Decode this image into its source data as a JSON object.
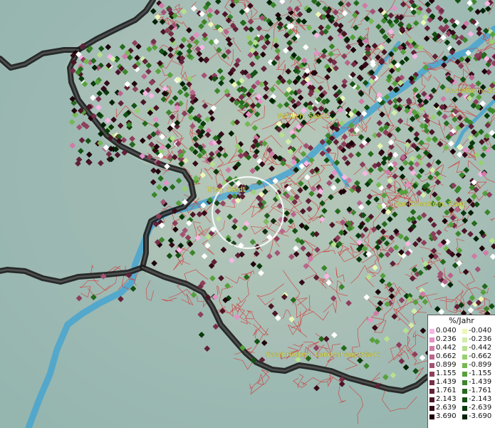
{
  "map": {
    "places": [
      {
        "id": "wittlich",
        "label": "Wittlich, Stadt"
      },
      {
        "id": "kastellaun",
        "label": "Kastellaun, Stadt"
      },
      {
        "id": "trier",
        "label": "Trier, Stadt"
      },
      {
        "id": "idar-oberstein",
        "label": "Idar-Oberstein, Stadt"
      },
      {
        "id": "saarbruecken",
        "label": "Saarbrücken, Landeshauptstadt"
      }
    ],
    "colors": {
      "background": "#8fb3ad",
      "rivers": "#46a4d0",
      "borders": "#1a1a1a",
      "municipality_lines": "#d23a3a",
      "place_labels": "#e8e24a"
    }
  },
  "legend": {
    "title": "%/Jahr",
    "rows": [
      {
        "pos": "0.040",
        "pos_color": "#f7b6e4",
        "neg": "-0.040",
        "neg_color": "#eaf7b6"
      },
      {
        "pos": "0.236",
        "pos_color": "#e391c6",
        "neg": "-0.236",
        "neg_color": "#d2edaa"
      },
      {
        "pos": "0.442",
        "pos_color": "#d07aa6",
        "neg": "-0.442",
        "neg_color": "#b8e08f"
      },
      {
        "pos": "0.662",
        "pos_color": "#b9658c",
        "neg": "-0.662",
        "neg_color": "#98cf71"
      },
      {
        "pos": "0.899",
        "pos_color": "#a45274",
        "neg": "-0.899",
        "neg_color": "#74b853"
      },
      {
        "pos": "1.155",
        "pos_color": "#8d3f5c",
        "neg": "-1.155",
        "neg_color": "#56a03c"
      },
      {
        "pos": "1.439",
        "pos_color": "#772e48",
        "neg": "-1.439",
        "neg_color": "#3b852a"
      },
      {
        "pos": "1.761",
        "pos_color": "#612137",
        "neg": "-1.761",
        "neg_color": "#256a1c"
      },
      {
        "pos": "2.143",
        "pos_color": "#4b1526",
        "neg": "-2.143",
        "neg_color": "#145113"
      },
      {
        "pos": "2.639",
        "pos_color": "#350b18",
        "neg": "-2.639",
        "neg_color": "#093a0b"
      },
      {
        "pos": "3.690",
        "pos_color": "#1f030b",
        "neg": "-3.690",
        "neg_color": "#022205"
      }
    ]
  }
}
